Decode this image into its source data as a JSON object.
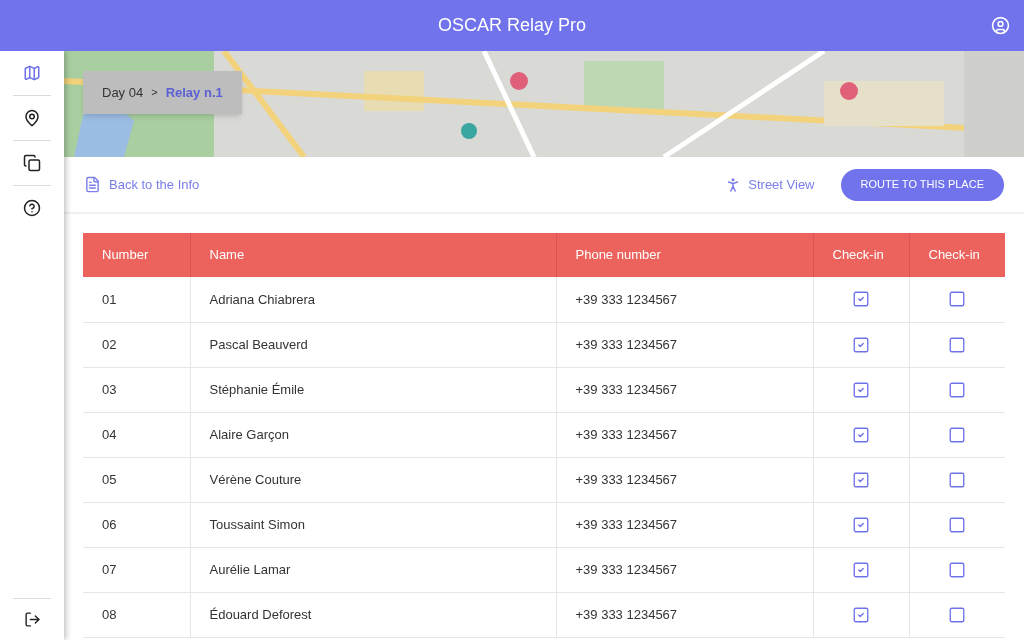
{
  "app_bar": {
    "title": "OSCAR Relay Pro"
  },
  "sidebar": {
    "items": [
      {
        "selected": true
      },
      {
        "selected": false
      },
      {
        "selected": false
      },
      {
        "selected": false
      }
    ]
  },
  "breadcrumb": {
    "day": "Day 04",
    "separator": ">",
    "current": "Relay n.1"
  },
  "toolbar": {
    "back_link": "Back to the Info",
    "street_view": "Street View",
    "route_button": "ROUTE TO THIS PLACE"
  },
  "table": {
    "columns": [
      "Number",
      "Name",
      "Phone number",
      "Check-in",
      "Check-in"
    ],
    "rows": [
      {
        "number": "01",
        "name": "Adriana Chiabrera",
        "phone": "+39 333 1234567",
        "check_in_1": true,
        "check_in_2": false
      },
      {
        "number": "02",
        "name": "Pascal Beauverd",
        "phone": "+39 333 1234567",
        "check_in_1": true,
        "check_in_2": false
      },
      {
        "number": "03",
        "name": "Stéphanie Émile",
        "phone": "+39 333 1234567",
        "check_in_1": true,
        "check_in_2": false
      },
      {
        "number": "04",
        "name": "Alaire Garçon",
        "phone": "+39 333 1234567",
        "check_in_1": true,
        "check_in_2": false
      },
      {
        "number": "05",
        "name": "Vérène Couture",
        "phone": "+39 333 1234567",
        "check_in_1": true,
        "check_in_2": false
      },
      {
        "number": "06",
        "name": "Toussaint Simon",
        "phone": "+39 333 1234567",
        "check_in_1": true,
        "check_in_2": false
      },
      {
        "number": "07",
        "name": "Aurélie Lamar",
        "phone": "+39 333 1234567",
        "check_in_1": true,
        "check_in_2": false
      },
      {
        "number": "08",
        "name": "Édouard Deforest",
        "phone": "+39 333 1234567",
        "check_in_1": true,
        "check_in_2": false
      }
    ]
  }
}
